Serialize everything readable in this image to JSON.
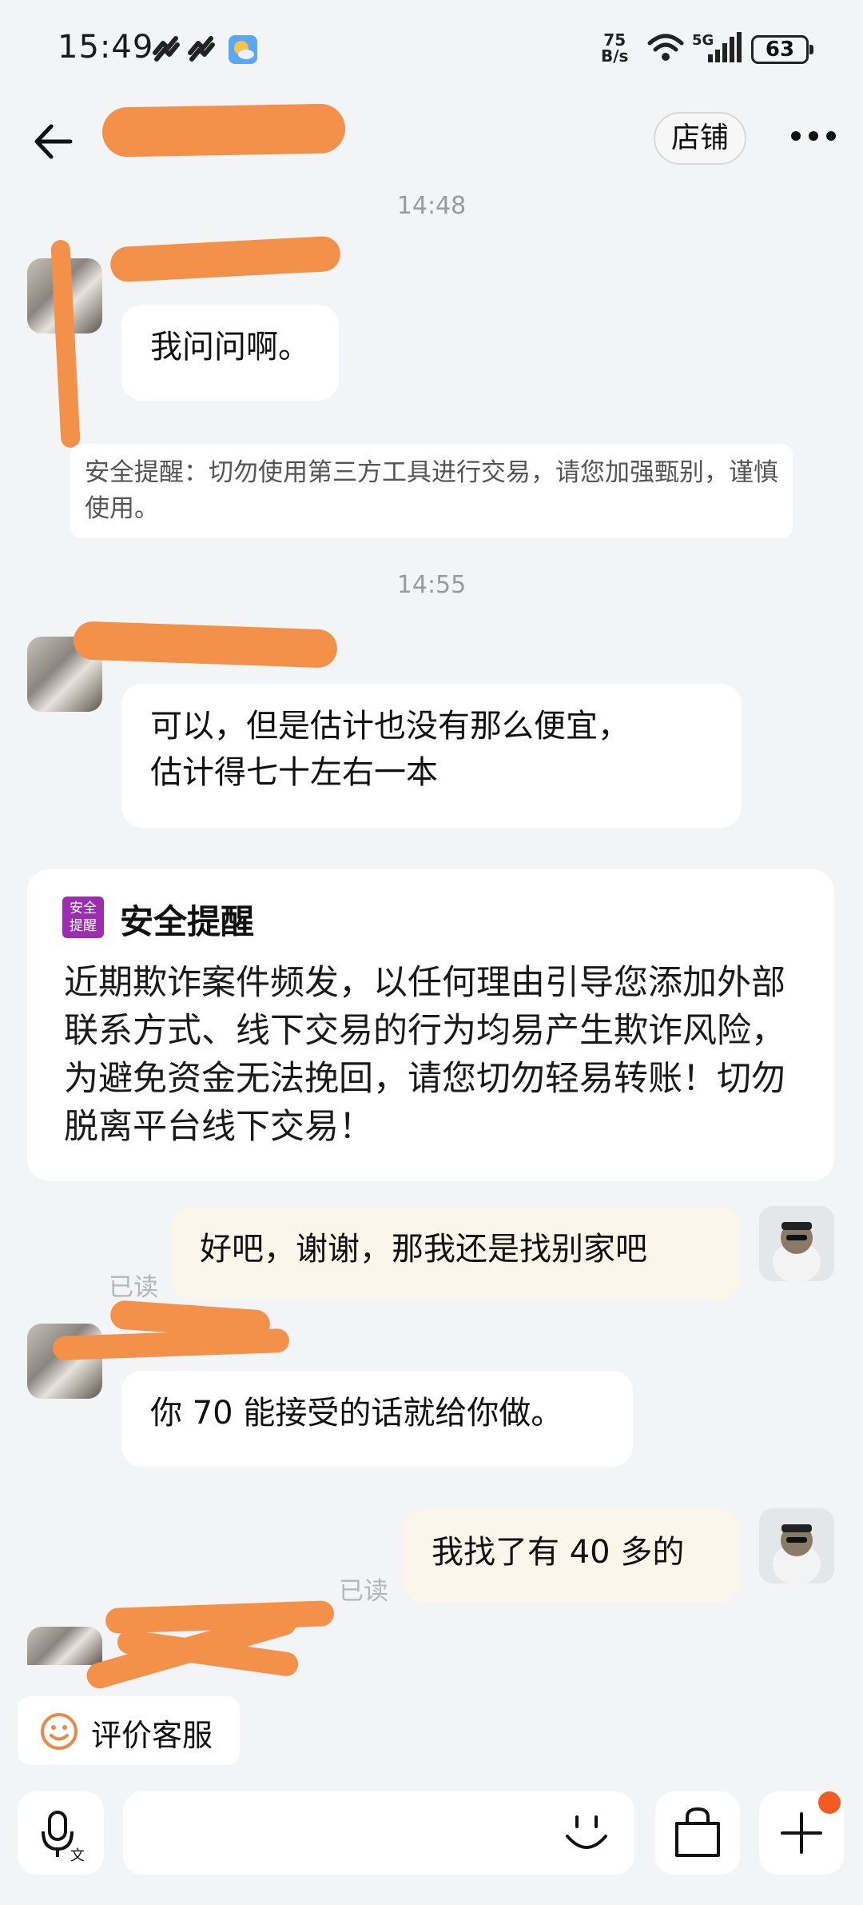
{
  "status_bar": {
    "time": "15:49",
    "net_speed_value": "75",
    "net_speed_unit": "B/s",
    "network": "5G",
    "battery": "63"
  },
  "header": {
    "store_label": "店铺"
  },
  "messages": {
    "time_1": "14:48",
    "msg_1": "我问问啊。",
    "notice_small": "安全提醒：切勿使用第三方工具进行交易，请您加强甄别，谨慎使用。",
    "time_2": "14:55",
    "msg_2_line1": "可以，但是估计也没有那么便宜，",
    "msg_2_line2": "估计得七十左右一本",
    "safety_card": {
      "badge_line1": "安全",
      "badge_line2": "提醒",
      "title": "安全提醒",
      "body": "近期欺诈案件频发，以任何理由引导您添加外部联系方式、线下交易的行为均易产生欺诈风险，为避免资金无法挽回，请您切勿轻易转账！切勿脱离平台线下交易！"
    },
    "msg_3": "好吧，谢谢，那我还是找别家吧",
    "read_1": "已读",
    "msg_4": "你 70 能接受的话就给你做。",
    "msg_5": "我找了有 40 多的",
    "read_2": "已读"
  },
  "review_button": {
    "label": "评价客服"
  },
  "colors": {
    "background": "#f3f4f6",
    "outgoing_bubble": "#fbf6ea",
    "incoming_bubble": "#ffffff",
    "safety_badge": "#9b2eae",
    "notification_dot": "#f25c22",
    "redaction": "#f3904a"
  }
}
